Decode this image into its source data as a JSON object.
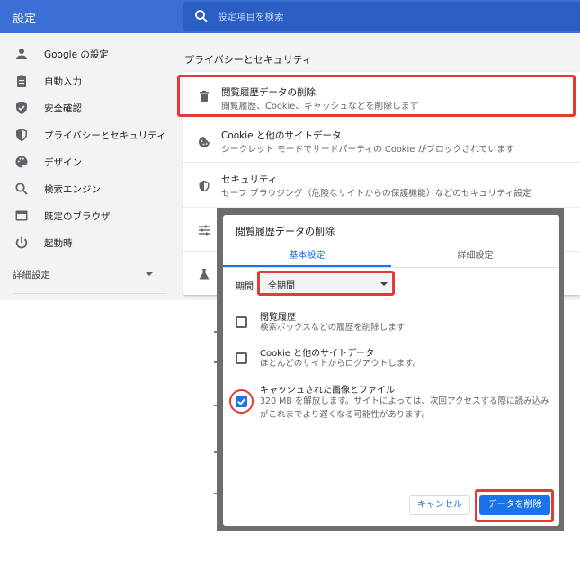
{
  "header": {
    "title": "設定",
    "search_placeholder": "設定項目を検索"
  },
  "sidebar": {
    "items": [
      {
        "label": "Google の設定",
        "icon": "person-icon"
      },
      {
        "label": "自動入力",
        "icon": "clipboard-icon"
      },
      {
        "label": "安全確認",
        "icon": "shield-check-icon"
      },
      {
        "label": "プライバシーとセキュリティ",
        "icon": "shield-icon"
      },
      {
        "label": "デザイン",
        "icon": "palette-icon"
      },
      {
        "label": "検索エンジン",
        "icon": "search-icon"
      },
      {
        "label": "既定のブラウザ",
        "icon": "browser-icon"
      },
      {
        "label": "起動時",
        "icon": "power-icon"
      }
    ],
    "advanced_label": "詳細設定"
  },
  "main": {
    "section_title": "プライバシーとセキュリティ",
    "rows": [
      {
        "title": "閲覧履歴データの削除",
        "subtitle": "閲覧履歴、Cookie、キャッシュなどを削除します",
        "icon": "trash-icon"
      },
      {
        "title": "Cookie と他のサイトデータ",
        "subtitle": "シークレット モードでサードパーティの Cookie がブロックされています",
        "icon": "cookie-icon"
      },
      {
        "title": "セキュリティ",
        "subtitle": "セーフ ブラウジング（危険なサイトからの保護機能）などのセキュリティ設定",
        "icon": "shield-icon"
      },
      {
        "title": "",
        "subtitle": "",
        "icon": "sliders-icon"
      },
      {
        "title": "",
        "subtitle": "",
        "icon": "flask-icon"
      }
    ]
  },
  "dialog": {
    "title": "閲覧履歴データの削除",
    "tabs": [
      {
        "label": "基本設定",
        "active": true
      },
      {
        "label": "詳細設定",
        "active": false
      }
    ],
    "period_label": "期間",
    "period_value": "全期間",
    "options": [
      {
        "title": "閲覧履歴",
        "subtitle": "検索ボックスなどの履歴を削除します",
        "checked": false
      },
      {
        "title": "Cookie と他のサイトデータ",
        "subtitle": "ほとんどのサイトからログアウトします。",
        "checked": false
      },
      {
        "title": "キャッシュされた画像とファイル",
        "subtitle_line1": "320 MB を解放します。サイトによっては、次回アクセスする際に読み込み",
        "subtitle_line2": "がこれまでより遅くなる可能性があります。",
        "checked": true
      }
    ],
    "cancel_label": "キャンセル",
    "delete_label": "データを削除"
  },
  "colors": {
    "header_bg": "#3b6fd6",
    "accent": "#1a73e8",
    "highlight": "#e53935"
  }
}
